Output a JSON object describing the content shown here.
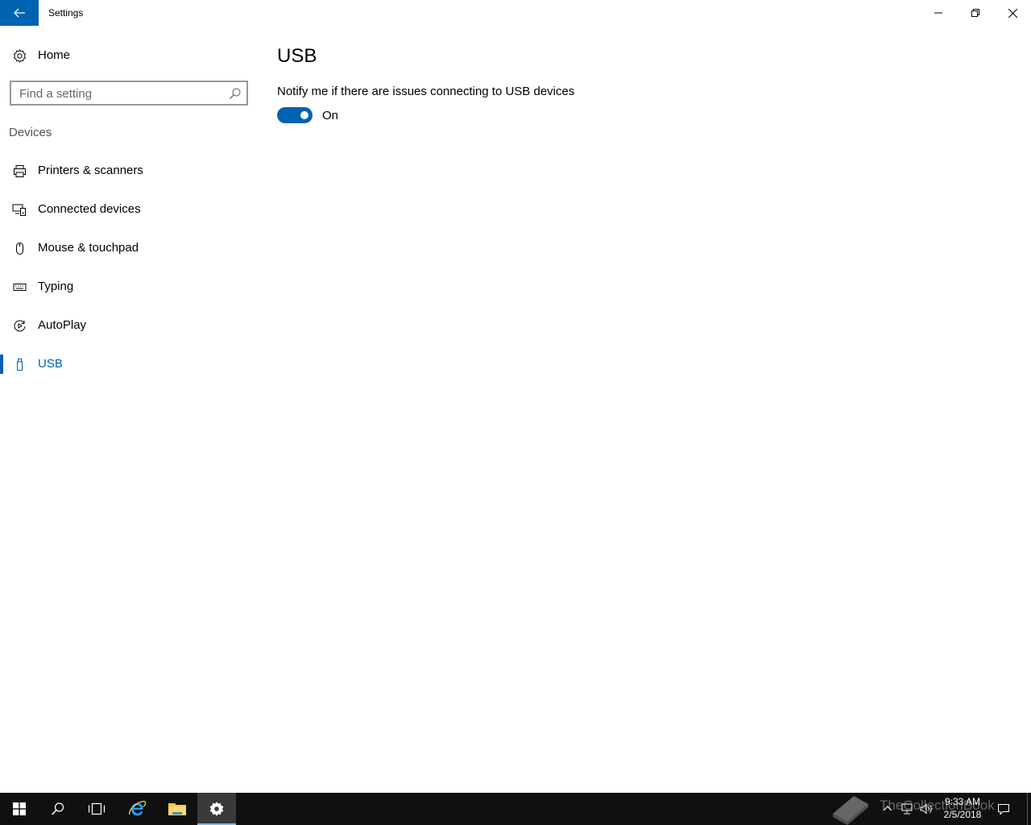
{
  "window": {
    "title": "Settings"
  },
  "sidebar": {
    "home_label": "Home",
    "search_placeholder": "Find a setting",
    "section": "Devices",
    "items": [
      {
        "label": "Printers & scanners",
        "icon": "printer-icon"
      },
      {
        "label": "Connected devices",
        "icon": "connected-devices-icon"
      },
      {
        "label": "Mouse & touchpad",
        "icon": "mouse-icon"
      },
      {
        "label": "Typing",
        "icon": "keyboard-icon"
      },
      {
        "label": "AutoPlay",
        "icon": "autoplay-icon"
      },
      {
        "label": "USB",
        "icon": "usb-icon",
        "selected": true
      }
    ]
  },
  "main": {
    "title": "USB",
    "setting": {
      "description": "Notify me if there are issues connecting to USB devices",
      "toggle_state": "On",
      "enabled": true
    }
  },
  "taskbar": {
    "watermark": "TheCollectionBook",
    "clock": {
      "time": "9:33 AM",
      "date": "2/5/2018"
    }
  },
  "colors": {
    "accent": "#0063b1",
    "taskbar": "#101010"
  }
}
